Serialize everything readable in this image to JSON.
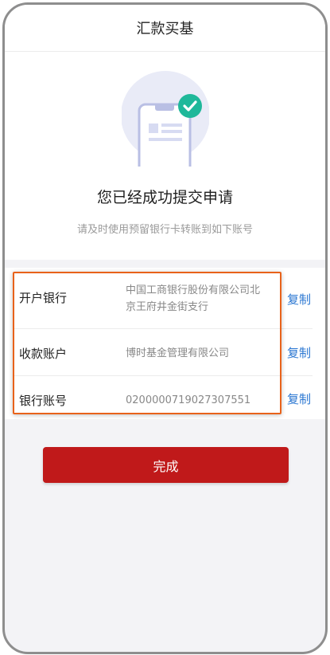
{
  "header": {
    "title": "汇款买基"
  },
  "success": {
    "title": "您已经成功提交申请",
    "subtitle": "请及时使用预留银行卡转账到如下账号"
  },
  "account_rows": [
    {
      "label": "开户银行",
      "value_line1": "中国工商银行股份有限公司北",
      "value_line2": "京王府井金街支行",
      "copy": "复制"
    },
    {
      "label": "收款账户",
      "value": "博时基金管理有限公司",
      "copy": "复制"
    },
    {
      "label": "银行账号",
      "value": "0200000719027307551",
      "copy": "复制"
    }
  ],
  "done_button": {
    "label": "完成"
  },
  "colors": {
    "accent": "#c0191a",
    "link": "#2b77d2",
    "highlight": "#e8621a",
    "success": "#1fb89a"
  }
}
